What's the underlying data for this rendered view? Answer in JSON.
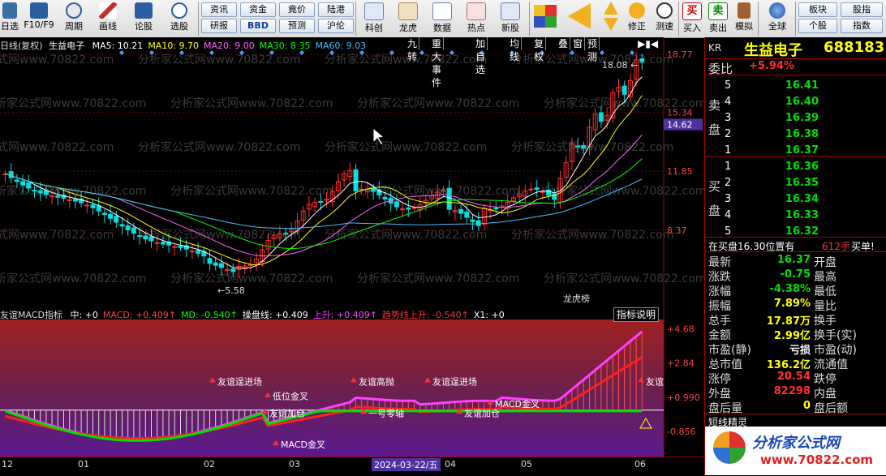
{
  "toolbar": {
    "items": [
      {
        "label": "日选",
        "sub": ""
      },
      {
        "label": "F10/F9"
      },
      {
        "label": "周期"
      },
      {
        "label": "画线"
      },
      {
        "label": "论股"
      },
      {
        "label": "选股"
      }
    ],
    "grid1": [
      "资讯",
      "资金",
      "竟价",
      "陆港",
      "研报",
      "BBD",
      "预测",
      "沪伦"
    ],
    "icons2": [
      "科创",
      "龙虎",
      "数据",
      "热点",
      "新股"
    ],
    "right_items": [
      "修正",
      "测速",
      "买入",
      "卖出",
      "模拟",
      "全球"
    ],
    "grid2": [
      "板块",
      "股指",
      "个股",
      "指数"
    ]
  },
  "kchart": {
    "title": "日线(复权)",
    "stock": "生益电子",
    "ma": [
      {
        "label": "MA5: 10.21",
        "color": "#ffffff"
      },
      {
        "label": "MA10: 9.70",
        "color": "#ffff00"
      },
      {
        "label": "MA20: 9.00",
        "color": "#ff60ff"
      },
      {
        "label": "MA30: 8.35",
        "color": "#00ff00"
      },
      {
        "label": "MA60: 9.03",
        "color": "#40c0ff"
      }
    ],
    "buttons": [
      "九转",
      "重大事件",
      "加自选",
      "均线",
      "复权",
      "叠",
      "窗",
      "预测"
    ],
    "yticks": [
      "18.77",
      "15.34",
      "11.85",
      "8.37"
    ],
    "current": "14.62",
    "high_label": "18.08",
    "low_label": "5.58",
    "watermark": "分析家公式网www.70822.com",
    "marker": "龙虎榜"
  },
  "macd": {
    "title": "友谊MACD指标",
    "params": [
      {
        "label": "中: +0",
        "color": "#ffffff"
      },
      {
        "label": "MACD: +0.409↑",
        "color": "#ff4040"
      },
      {
        "label": "MD: -0.540↑",
        "color": "#00ff00"
      },
      {
        "label": "操盘线: +0.409",
        "color": "#ffffff"
      },
      {
        "label": "上升: +0.409↑",
        "color": "#ff40ff"
      },
      {
        "label": "趋势线上升: -0.540↑",
        "color": "#ff3030"
      },
      {
        "label": "X1: +0",
        "color": "#ffffff"
      }
    ],
    "explain_button": "指标说明",
    "yticks": [
      "+4.68",
      "+2.84",
      "+0.990",
      "-0.856"
    ],
    "annotations": [
      {
        "text": "友谊逞进场",
        "kind": "up"
      },
      {
        "text": "低位金叉",
        "kind": "up"
      },
      {
        "text": "友谊加仓",
        "kind": "up"
      },
      {
        "text": "MACD金叉",
        "kind": "up"
      },
      {
        "text": "友谊高抛",
        "kind": "up"
      },
      {
        "text": "一号零轴",
        "kind": "up"
      },
      {
        "text": "友谊逞进场",
        "kind": "up"
      },
      {
        "text": "MACD金叉",
        "kind": "up"
      },
      {
        "text": "友谊加仓",
        "kind": "up"
      },
      {
        "text": "友谊",
        "kind": "up"
      }
    ]
  },
  "xaxis": {
    "labels": [
      "12",
      "01",
      "02",
      "03",
      "04",
      "05",
      "06"
    ],
    "cursor_date": "2024-03-22/五"
  },
  "quote": {
    "market": "KR",
    "name": "生益电子",
    "code": "688183",
    "weibi_label": "委比",
    "weibi": "+5.94%",
    "sell_label": "卖盘",
    "buy_label": "买盘",
    "sells": [
      {
        "lvl": "5",
        "price": "16.41"
      },
      {
        "lvl": "4",
        "price": "16.40"
      },
      {
        "lvl": "3",
        "price": "16.39"
      },
      {
        "lvl": "2",
        "price": "16.38"
      },
      {
        "lvl": "1",
        "price": "16.37"
      }
    ],
    "buys": [
      {
        "lvl": "1",
        "price": "16.36"
      },
      {
        "lvl": "2",
        "price": "16.35"
      },
      {
        "lvl": "3",
        "price": "16.34"
      },
      {
        "lvl": "4",
        "price": "16.33"
      },
      {
        "lvl": "5",
        "price": "16.32"
      }
    ],
    "note": "在买盘16.30位置有",
    "note_qty": "612手",
    "note_tag": "买单!",
    "stats_left": [
      {
        "label": "最新",
        "value": "16.37",
        "color": "#00e000"
      },
      {
        "label": "涨跌",
        "value": "-0.75",
        "color": "#00e000"
      },
      {
        "label": "涨幅",
        "value": "-4.38%",
        "color": "#00e000"
      },
      {
        "label": "振幅",
        "value": "7.89%",
        "color": "#ffff00"
      },
      {
        "label": "总手",
        "value": "17.87万",
        "color": "#ffff00"
      },
      {
        "label": "金额",
        "value": "2.99亿",
        "color": "#ffff00"
      },
      {
        "label": "市盈(静)",
        "value": "亏损",
        "color": "#ffffff"
      },
      {
        "label": "总市值",
        "value": "136.2亿",
        "color": "#ffff00"
      },
      {
        "label": "涨停",
        "value": "20.54",
        "color": "#ff3030"
      },
      {
        "label": "外盘",
        "value": "82298",
        "color": "#ff3030"
      },
      {
        "label": "盘后量",
        "value": "0",
        "color": "#ffff00"
      }
    ],
    "stats_right": [
      "开盘",
      "最高",
      "最低",
      "量比",
      "换手",
      "换手(实)",
      "市盈(动)",
      "流通值",
      "跌停",
      "内盘",
      "盘后额"
    ],
    "short_title": "短线精灵",
    "logo_text": "分析家公式网",
    "logo_url": "www.70822.com"
  }
}
